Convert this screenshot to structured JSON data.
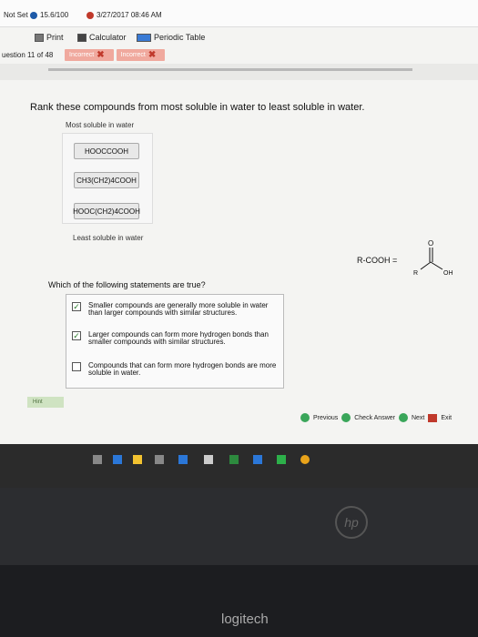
{
  "status_bar": {
    "not_set": "Not Set",
    "score": "15.6/100",
    "date": "3/27/2017 08:46 AM"
  },
  "toolbar": {
    "print_label": "Print",
    "calculator_label": "Calculator",
    "periodic_table_label": "Periodic Table"
  },
  "question_nav": {
    "label": "uestion 11 of 48",
    "attempts": [
      "Incorrect",
      "Incorrect"
    ]
  },
  "question": {
    "prompt": "Rank these compounds from most soluble in water to least soluble in water.",
    "most_label": "Most soluble in water",
    "least_label": "Least soluble in water",
    "compounds": [
      "HOOCCOOH",
      "CH3(CH2)4COOH",
      "HOOC(CH2)4COOH"
    ],
    "rcooh_label": "R-COOH  ="
  },
  "structure": {
    "o_label": "O",
    "r_label": "R",
    "oh_label": "OH"
  },
  "statements": {
    "prompt": "Which of the following statements are true?",
    "items": [
      {
        "text": "Smaller compounds are generally more soluble in water than larger compounds with similar structures.",
        "checked": true
      },
      {
        "text": "Larger compounds can form more hydrogen bonds than smaller compounds with similar structures.",
        "checked": true
      },
      {
        "text": "Compounds that can form more hydrogen bonds are more soluble in water.",
        "checked": false
      }
    ]
  },
  "footer": {
    "hint": "Hint",
    "previous": "Previous",
    "check_answer": "Check Answer",
    "next": "Next",
    "exit": "Exit"
  },
  "hp_logo": "hp",
  "keyboard_brand": "logitech"
}
